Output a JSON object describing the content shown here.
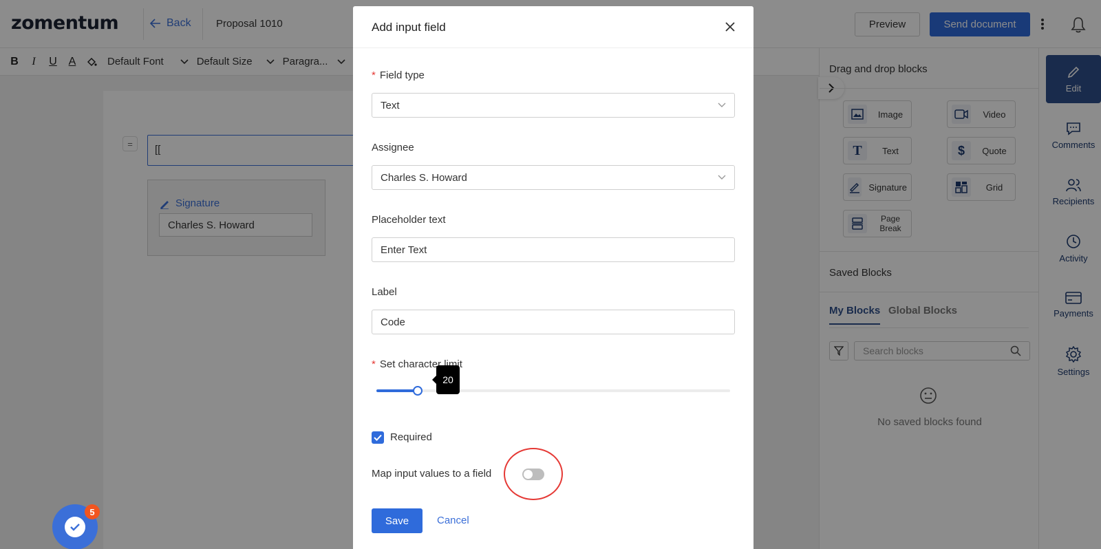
{
  "header": {
    "logo": "zomentum",
    "back_label": "Back",
    "doc_title": "Proposal 1010",
    "preview_label": "Preview",
    "send_label": "Send document"
  },
  "toolbar": {
    "bold": "B",
    "italic": "I",
    "underline": "U",
    "font_color": "A",
    "font": "Default Font",
    "size": "Default Size",
    "paragraph": "Paragra..."
  },
  "editor": {
    "text_block_value": "[[",
    "signature_label": "Signature",
    "signature_value": "Charles S. Howard"
  },
  "blocks_panel": {
    "title": "Drag and drop blocks",
    "blocks": [
      {
        "label": "Image",
        "icon": "image-icon"
      },
      {
        "label": "Video",
        "icon": "video-icon"
      },
      {
        "label": "Text",
        "icon": "text-icon"
      },
      {
        "label": "Quote",
        "icon": "dollar-icon"
      },
      {
        "label": "Signature",
        "icon": "signature-icon"
      },
      {
        "label": "Grid",
        "icon": "grid-icon"
      },
      {
        "label": "Page Break",
        "icon": "page-break-icon"
      }
    ],
    "saved_title": "Saved Blocks",
    "tabs": [
      "My Blocks",
      "Global Blocks"
    ],
    "search_placeholder": "Search blocks",
    "empty_text": "No saved blocks found"
  },
  "side_nav": [
    {
      "label": "Edit",
      "icon": "pencil-icon",
      "active": true
    },
    {
      "label": "Comments",
      "icon": "comment-icon",
      "active": false
    },
    {
      "label": "Recipients",
      "icon": "users-icon",
      "active": false
    },
    {
      "label": "Activity",
      "icon": "clock-icon",
      "active": false
    },
    {
      "label": "Payments",
      "icon": "card-icon",
      "active": false
    },
    {
      "label": "Settings",
      "icon": "gear-icon",
      "active": false
    }
  ],
  "modal": {
    "title": "Add input field",
    "field_type": {
      "label": "Field type",
      "value": "Text"
    },
    "assignee": {
      "label": "Assignee",
      "value": "Charles S. Howard"
    },
    "placeholder": {
      "label": "Placeholder text",
      "value": "Enter Text"
    },
    "field_label": {
      "label": "Label",
      "value": "Code"
    },
    "char_limit": {
      "label": "Set character limit",
      "value": "20"
    },
    "required": {
      "label": "Required",
      "checked": true
    },
    "map_values": {
      "label": "Map input values to a field",
      "enabled": false
    },
    "save_label": "Save",
    "cancel_label": "Cancel"
  },
  "tasks_badge": {
    "count": "5"
  },
  "colors": {
    "primary": "#2f6bdb",
    "nav_active": "#2f4f8a",
    "badge": "#f2551f",
    "annotation": "#e53935"
  }
}
